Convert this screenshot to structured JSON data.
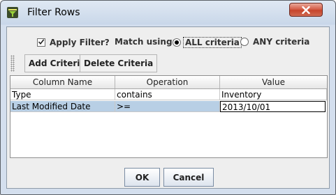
{
  "window": {
    "title": "Filter Rows",
    "icons": {
      "app": "filter-app-icon",
      "close": "close-icon"
    }
  },
  "options": {
    "apply_filter_label": "Apply Filter?",
    "apply_filter_checked": true,
    "match_using_label": "Match using:",
    "radio_all_label": "ALL criteria",
    "radio_any_label": "ANY criteria",
    "selected_match": "ALL criteria"
  },
  "toolbar": {
    "add_label": "Add Criteria",
    "delete_label": "Delete Criteria"
  },
  "table": {
    "columns": [
      "Column Name",
      "Operation",
      "Value"
    ],
    "rows": [
      {
        "column": "Type",
        "operation": "contains",
        "value": "Inventory"
      },
      {
        "column": "Last Modified Date",
        "operation": ">=",
        "value": "2013/10/01"
      }
    ],
    "selected_row": 2
  },
  "buttons": {
    "ok": "OK",
    "cancel": "Cancel"
  },
  "colors": {
    "selection": "#b8cfe5",
    "close_button": "#c7452c",
    "window_frame": "#d4dfee"
  }
}
